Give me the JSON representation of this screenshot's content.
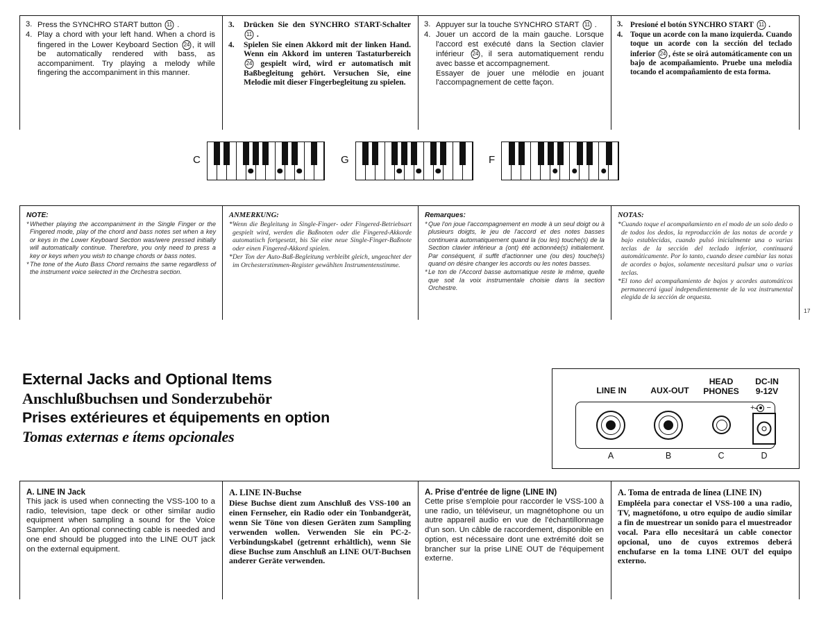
{
  "page_number": "17",
  "instructions": {
    "english": {
      "lang": "en",
      "steps": [
        {
          "num": "3.",
          "pre": "Press the SYNCHRO START button ",
          "circled": "11",
          "post": " ."
        },
        {
          "num": "4.",
          "pre": "Play a chord with your left hand. When a chord is fingered in the Lower Keyboard Section ",
          "circled": "24",
          "post": ", it will be automatically rendered with bass, as accompaniment. Try playing a melody while fingering the accompaniment in this manner."
        }
      ]
    },
    "german": {
      "lang": "de",
      "steps": [
        {
          "num": "3.",
          "pre": "Drücken Sie den SYNCHRO START-Schalter ",
          "circled": "11",
          "post": " ."
        },
        {
          "num": "4.",
          "pre": "Spielen Sie einen Akkord mit der linken Hand. Wenn ein Akkord im unteren Tastaturbereich ",
          "circled": "24",
          "post": " gespielt wird, wird er automatisch mit Baßbegleitung gehört. Versuchen Sie, eine Melodie mit dieser Fingerbegleitung zu spielen."
        }
      ]
    },
    "french": {
      "lang": "fr",
      "steps": [
        {
          "num": "3.",
          "pre": "Appuyer sur la touche SYNCHRO START ",
          "circled": "11",
          "post": " ."
        },
        {
          "num": "4.",
          "pre": "Jouer un accord de la main gauche. Lorsque l'accord est exécuté dans la Section clavier inférieur ",
          "circled": "24",
          "post": ", il sera automatiquement rendu avec basse et accompagnement."
        },
        {
          "num": "",
          "pre": "Essayer de jouer une mélodie en jouant l'accompagnement de cette façon.",
          "circled": "",
          "post": ""
        }
      ]
    },
    "spanish": {
      "lang": "es",
      "steps": [
        {
          "num": "3.",
          "pre": "Presioné el botón SYNCHRO START ",
          "circled": "11",
          "post": " ."
        },
        {
          "num": "4.",
          "pre": "Toque un acorde con la mano izquierda. Cuando toque un acorde con la sección del teclado inferior ",
          "circled": "24",
          "post": ", éste se oirá automáticamente con un bajo de acompañamiento. Pruebe una melodía tocando el acompañamiento de  esta forma."
        }
      ]
    }
  },
  "keyboards": [
    {
      "label": "C",
      "white_keys": 12,
      "black_key_positions": [
        1,
        2,
        4,
        5,
        6,
        8,
        9,
        11
      ],
      "dot_white_keys": [
        5,
        8,
        10
      ]
    },
    {
      "label": "G",
      "white_keys": 12,
      "black_key_positions": [
        1,
        2,
        4,
        5,
        6,
        8,
        9,
        11
      ],
      "dot_white_keys": [
        5,
        7,
        9
      ]
    },
    {
      "label": "F",
      "white_keys": 12,
      "black_key_positions": [
        1,
        2,
        4,
        5,
        6,
        8,
        9,
        11
      ],
      "dot_white_keys": [
        6,
        8,
        11
      ]
    }
  ],
  "notes": {
    "english": {
      "heading": "NOTE:",
      "items": [
        "Whether playing the accompaniment in the Single Finger or the Fingered mode, play of the chord and bass notes set when a key or keys in the Lower Keyboard Section was/were pressed initially will automatically continue. Therefore, you only need to press a key or keys when you wish to change chords or bass notes.",
        "The tone of the Auto Bass Chord remains the same regardless of the instrument voice selected in the Orchestra section."
      ]
    },
    "german": {
      "heading": "ANMERKUNG:",
      "items": [
        "Wenn die Begleitung in Single-Finger- oder Fingered-Betriebsart gespielt wird, werden die Baßnoten oder die Fingered-Akkorde automatisch fortgesetzt, bis Sie eine neue Single-Finger-Baßnote oder einen Fingered-Akkord spielen.",
        "Der Ton der Auto-Baß-Begleitung verbleibt gleich, ungeachtet der im Orchesterstimmen-Register gewählten Instrumentenstimme."
      ]
    },
    "french": {
      "heading": "Remarques:",
      "items": [
        "Que l'on joue l'accompagnement en mode à un seul doigt ou à plusieurs doigts, le jeu de l'accord et des notes basses continuera automatiquement quand la (ou les) touche(s) de la Section clavier inférieur a (ont) été actionnée(s) initialement. Par conséquent, il suffit d'actionner une (ou des) touche(s) quand on désire changer les accords ou les notes basses.",
        "Le ton de l'Accord basse automatique reste le même, quelle que soit la voix instrumentale choisie dans la section Orchestre."
      ]
    },
    "spanish": {
      "heading": "NOTAS:",
      "items": [
        "Cuando toque el acompañamiento en el modo de un solo dedo o de todos los dedos, la reproducción de las notas de acorde y bajo establecidas, cuando pulsó inicialmente una o varias teclas de la sección del teclado inferior, continuará automáticamente. Por lo tanto, cuando desee cambiar las notas de acordes o bajos, solamente necesitará pulsar una o varias teclas.",
        "El tono del acompañamiento de bajos y acordes automáticos permanecerá igual independientemente de la voz instrumental elegida de la sección de orquesta."
      ]
    }
  },
  "section_titles": {
    "english": "External Jacks and Optional Items",
    "german": "Anschlußbuchsen und Sonderzubehör",
    "french": "Prises extérieures et équipements en option",
    "spanish": "Tomas externas e ítems opcionales"
  },
  "panel": {
    "labels": {
      "line_in": "LINE IN",
      "aux_out": "AUX-OUT",
      "head_phones": "HEAD\nPHONES",
      "dc_in": "DC-IN\n9-12V"
    },
    "polarity": {
      "plus": "+",
      "minus": "−"
    },
    "letters": [
      "A",
      "B",
      "C",
      "D"
    ]
  },
  "jack_descriptions": {
    "english": {
      "heading": "A. LINE IN Jack",
      "body": "This jack is used when connecting the VSS-100 to a radio, television, tape deck or other similar audio equipment when sampling a sound for the Voice Sampler. An optional connecting cable is needed and one end should be plugged into the LINE OUT jack on the external equipment."
    },
    "german": {
      "heading": "A. LINE IN-Buchse",
      "body": "Diese Buchse dient zum Anschluß des VSS-100 an einen Fernseher, ein Radio oder ein Tonbandgerät, wenn Sie Töne von diesen Geräten zum Sampling verwenden wollen. Verwenden Sie ein PC-2-Verbindungskabel (getrennt erhältlich), wenn Sie diese Buchse zum Anschluß an LINE OUT-Buchsen anderer Geräte verwenden."
    },
    "french": {
      "heading": "A. Prise d'entrée de ligne (LINE IN)",
      "body": "Cette prise s'emploie pour raccorder le VSS-100 à une radio, un téléviseur, un magnétophone ou un autre appareil audio en vue de l'échantillonnage d'un son. Un câble de raccordement, disponible en option, est nécessaire dont une extrémité doit se brancher sur la prise LINE OUT de l'équipement externe."
    },
    "spanish": {
      "heading": "A. Toma de entrada de línea (LINE IN)",
      "body": "Empléela para conectar el VSS-100 a una radio, TV, magnetófono, u otro equipo de audio similar a fin de muestrear un sonido para el muestreador vocal. Para ello necesitará un cable conector opcional, uno de cuyos extremos deberá enchufarse en la toma LINE OUT del equipo externo."
    }
  }
}
